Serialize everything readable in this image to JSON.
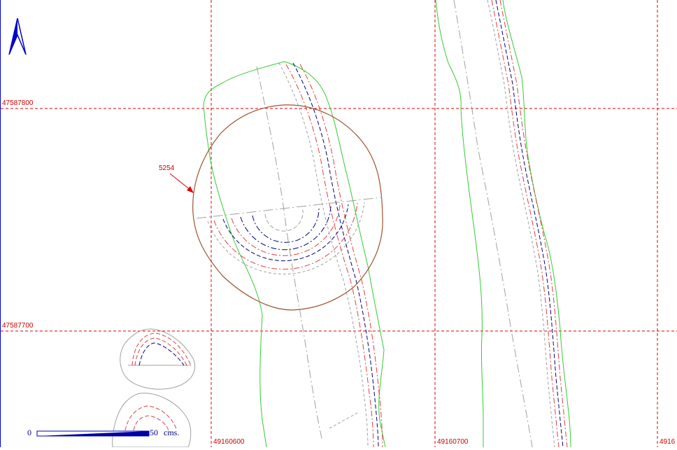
{
  "map": {
    "north_arrow": "north-arrow-icon",
    "grid": {
      "x_labels": [
        "49160600",
        "49160700",
        "4916"
      ],
      "y_labels": [
        "47587800",
        "47587700"
      ],
      "color": "#e00000"
    },
    "feature_label": "5254",
    "scale_bar": {
      "start": "0",
      "end": "50",
      "unit": "cms."
    },
    "colors": {
      "outline_green": "#33cc33",
      "feature_brown": "#a0522d",
      "contour_blue": "#000080",
      "contour_red": "#e04040",
      "axis_gray": "#a0a0a0"
    }
  }
}
